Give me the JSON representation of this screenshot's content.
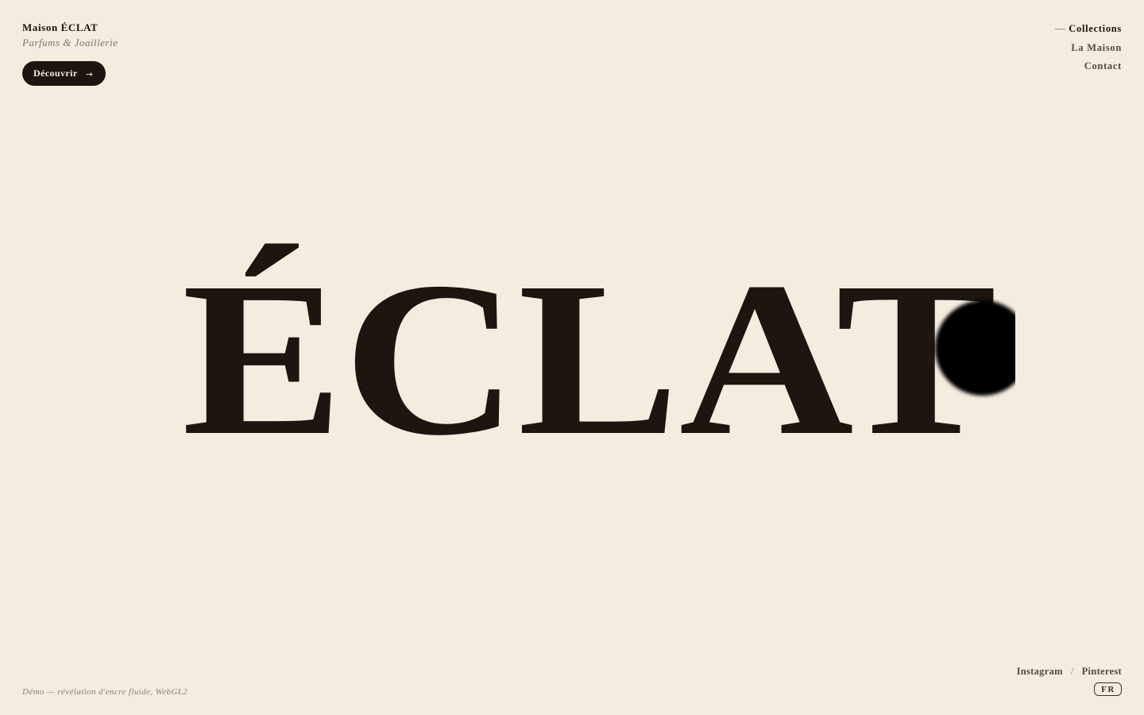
{
  "brand": {
    "name": "Maison ÉCLAT",
    "tagline": "Parfums & Joaillerie"
  },
  "cta": {
    "label": "Découvrir",
    "arrow": "→"
  },
  "nav": {
    "active_prefix": "—",
    "items": [
      {
        "label": "Collections",
        "active": true
      },
      {
        "label": "La Maison",
        "active": false
      },
      {
        "label": "Contact",
        "active": false
      }
    ]
  },
  "hero": {
    "word": "ÉCLAT",
    "ink_color": "#1c1510",
    "blob_color": "#000000"
  },
  "footer": {
    "note": "Démo — révélation d'encre fluide, WebGL2",
    "social": {
      "items": [
        "Instagram",
        "Pinterest"
      ],
      "separator": "/"
    },
    "language": "FR"
  },
  "colors": {
    "background": "#f4ecdf",
    "ink": "#1c1510",
    "muted": "#7d7468"
  }
}
